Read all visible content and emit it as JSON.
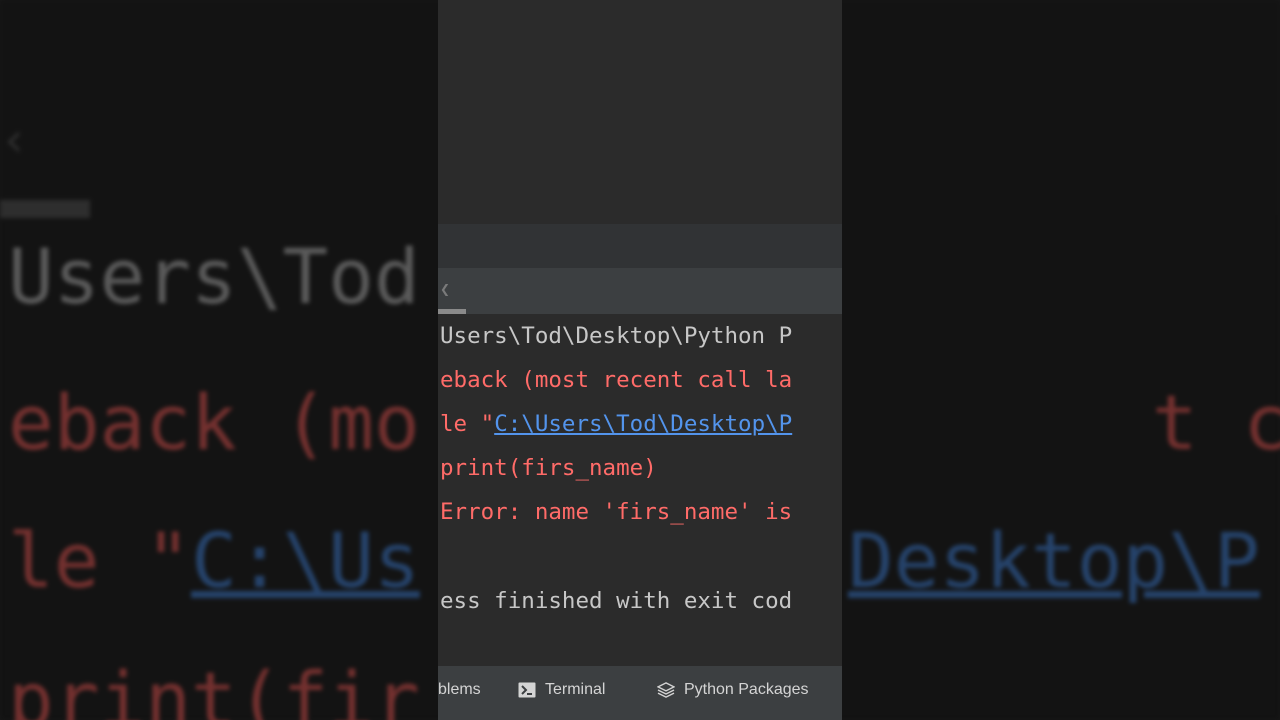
{
  "console": {
    "lines": [
      {
        "text": "Users\\Tod\\Desktop\\Python P",
        "kind": "normal"
      },
      {
        "text": "eback (most recent call la",
        "kind": "error"
      },
      {
        "prefix": "le \"",
        "link": "C:\\Users\\Tod\\Desktop\\P",
        "kind": "error"
      },
      {
        "text": "print(firs_name)",
        "kind": "error"
      },
      {
        "text": "Error: name 'firs_name' is",
        "kind": "error"
      },
      {
        "text": "ess finished with exit cod",
        "kind": "normal"
      }
    ]
  },
  "background": {
    "line1": "Users\\Tod                   \\Python P",
    "line2": "eback (mo                t call la",
    "line3_prefix": "le \"",
    "line3_link": "C:\\Us",
    "line3_link_right": "Desktop\\P",
    "line4": "print(fir"
  },
  "statusbar": {
    "problems": "blems",
    "terminal": "Terminal",
    "python_packages": "Python Packages"
  },
  "colors": {
    "error": "#ff6b68",
    "link": "#5394ec",
    "text": "#c7c7c7",
    "statusbar_bg": "#3c3f41"
  },
  "icons": {
    "terminal": "terminal-icon",
    "python_packages": "layers-icon",
    "tab_scroll": "chevron-left-icon"
  }
}
